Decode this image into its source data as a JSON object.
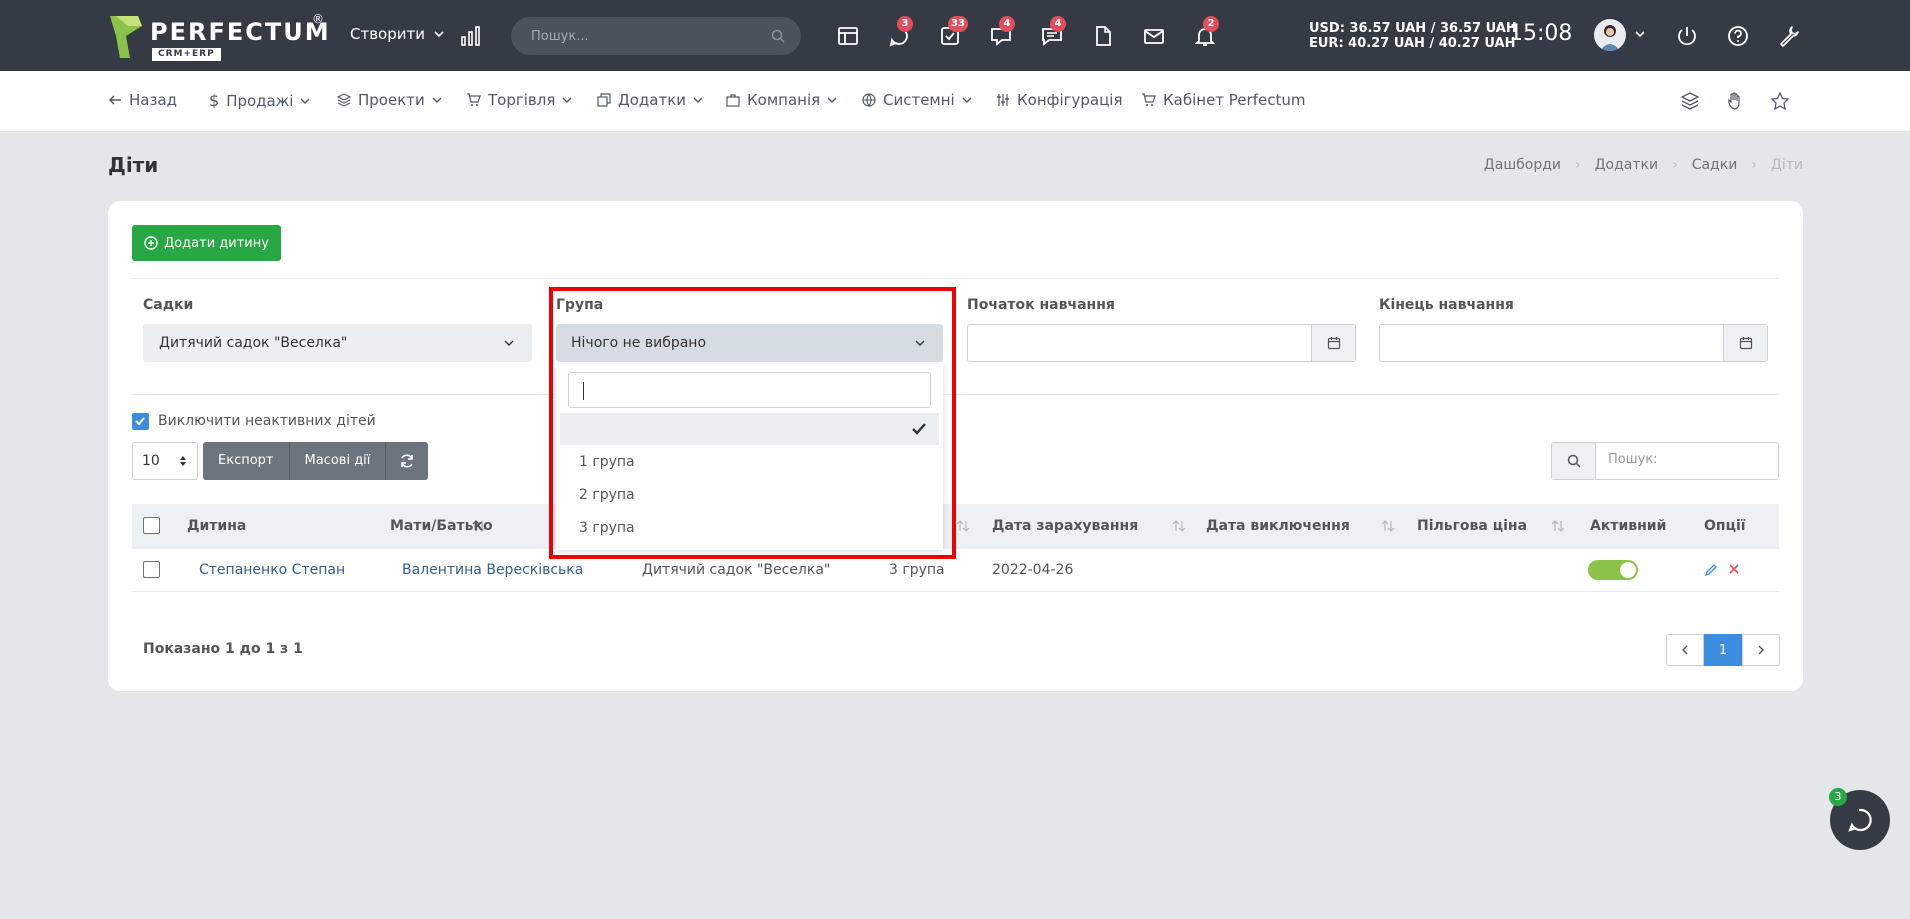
{
  "header": {
    "logo_text": "PERFECTUM",
    "logo_reg": "®",
    "logo_sub": "CRM+ERP",
    "create_label": "Створити",
    "search_placeholder": "Пошук...",
    "badges": {
      "chat": "3",
      "tasks": "33",
      "messages": "4",
      "comments": "4",
      "notifications": "2"
    },
    "currency_usd": "USD: 36.57 UAH / 36.57 UAH",
    "currency_eur": "EUR: 40.27 UAH / 40.27 UAH",
    "time": "15:08"
  },
  "nav": {
    "back": "Назад",
    "sales": "Продажі",
    "projects": "Проекти",
    "trade": "Торгівля",
    "addons": "Додатки",
    "company": "Компанія",
    "system": "Системні",
    "config": "Конфігурація",
    "cabinet": "Кабінет Perfectum"
  },
  "page": {
    "title": "Діти",
    "breadcrumbs": [
      "Дашборди",
      "Додатки",
      "Садки",
      "Діти"
    ]
  },
  "toolbar": {
    "add_label": "Додати дитину"
  },
  "filters": {
    "kindergarten_label": "Садки",
    "kindergarten_value": "Дитячий садок \"Веселка\"",
    "group_label": "Група",
    "group_value": "Нічого не вибрано",
    "start_label": "Початок навчання",
    "end_label": "Кінець навчання",
    "exclude_label": "Виключити неактивних дітей",
    "exclude_checked": true
  },
  "group_dropdown": {
    "options": [
      "",
      "1 група",
      "2 група",
      "3 група"
    ]
  },
  "table_controls": {
    "page_length": "10",
    "export_label": "Експорт",
    "bulk_label": "Масові дії",
    "search_placeholder": "Пошук:"
  },
  "table": {
    "columns": [
      "Дитина",
      "Мати/Батько",
      "Дата зарахування",
      "Дата виключення",
      "Пільгова ціна",
      "Активний",
      "Опції"
    ],
    "rows": [
      {
        "child": "Степаненко Степан",
        "parent": "Валентина Вересківська",
        "kindergarten": "Дитячий садок \"Веселка\"",
        "group": "3 група",
        "enrolled": "2022-04-26",
        "excluded": "",
        "discount": "",
        "active": true
      }
    ]
  },
  "footer": {
    "shown": "Показано 1 до 1 з 1",
    "current_page": "1"
  },
  "chat": {
    "badge": "3"
  },
  "colors": {
    "topbar": "#343b44",
    "accent_green": "#28a745",
    "primary_blue": "#3c8dde",
    "badge_red": "#e44d5b",
    "highlight_red": "#ee0000",
    "toggle_green": "#8bc34a"
  }
}
